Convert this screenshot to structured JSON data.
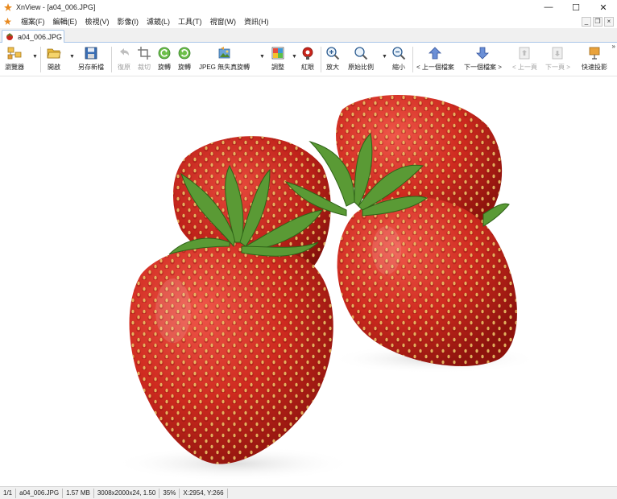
{
  "window": {
    "title": "XnView - [a04_006.JPG]",
    "controls": {
      "minimize": "—",
      "maximize": "☐",
      "close": "✕"
    },
    "mdi_controls": {
      "minimize": "_",
      "restore": "❐",
      "close": "×"
    }
  },
  "menu": {
    "items": [
      "檔案(F)",
      "編輯(E)",
      "檢視(V)",
      "影像(I)",
      "濾鏡(L)",
      "工具(T)",
      "視窗(W)",
      "資訊(H)"
    ]
  },
  "tab": {
    "label": "a04_006.JPG"
  },
  "toolbar": {
    "browser": "瀏覽器",
    "open": "開啟",
    "save_as": "另存新檔",
    "undo": "復原",
    "crop": "裁切",
    "rotate_left": "旋轉",
    "rotate_right": "旋轉",
    "jpeg_lossless": "JPEG 無失真旋轉",
    "adjust": "調整",
    "red_eye": "紅眼",
    "zoom_in": "放大",
    "original_ratio": "原始比例",
    "zoom_out": "縮小",
    "prev_file": "< 上一個檔案",
    "next_file": "下一個檔案 >",
    "prev_page": "< 上一頁",
    "next_page": "下一頁 >",
    "slideshow": "快速投影",
    "overflow": "»"
  },
  "icons": {
    "browser": "browser-icon",
    "open": "folder-open-icon",
    "save": "floppy-disk-icon",
    "undo": "undo-icon",
    "crop": "crop-icon",
    "rotate_left": "rotate-left-icon",
    "rotate_right": "rotate-right-icon",
    "jpeg": "jpeg-rotate-icon",
    "adjust": "adjust-icon",
    "red_eye": "red-eye-icon",
    "zoom_in": "zoom-in-icon",
    "original": "zoom-original-icon",
    "zoom_out": "zoom-out-icon",
    "prev_file": "arrow-up-icon",
    "next_file": "arrow-down-icon",
    "prev_page": "page-prev-icon",
    "next_page": "page-next-icon",
    "slideshow": "slideshow-icon"
  },
  "image": {
    "content": "strawberries"
  },
  "status": {
    "index": "1/1",
    "filename": "a04_006.JPG",
    "filesize": "1.57 MB",
    "dimensions": "3008x2000x24, 1.50",
    "zoom": "35%",
    "cursor": "X:2954, Y:266"
  },
  "colors": {
    "accent_blue": "#a9c6e8",
    "strawberry_red": "#c9261c",
    "leaf_green": "#4f8a2e"
  }
}
